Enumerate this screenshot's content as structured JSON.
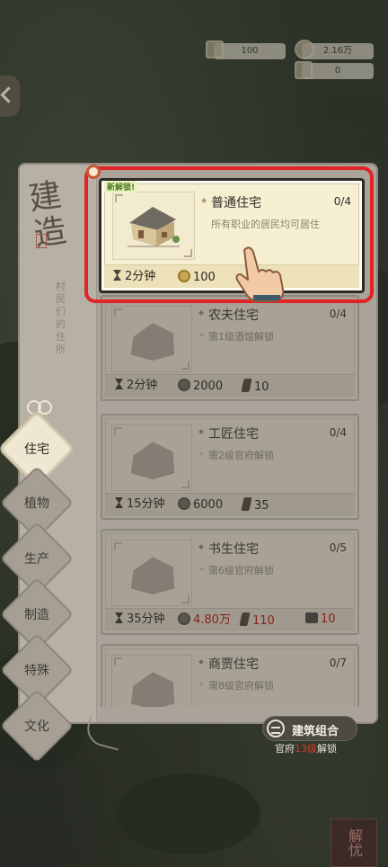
{
  "resources": {
    "wood_value": "100",
    "coin_value": "2.16万",
    "stone_value": "0"
  },
  "side": {
    "title": "建造",
    "subtitle": "村民们的住所"
  },
  "highlighted": {
    "tag": "新解锁!",
    "name": "普通住宅",
    "count": "0/4",
    "desc": "所有职业的居民均可居住",
    "time": "2分钟",
    "coins": "100"
  },
  "buildings": [
    {
      "name": "农夫住宅",
      "count": "0/4",
      "req": "需1级酒馆解锁",
      "time": "2分钟",
      "coins": "2000",
      "wood": "10",
      "stone": ""
    },
    {
      "name": "工匠住宅",
      "count": "0/4",
      "req": "需2级官府解锁",
      "time": "15分钟",
      "coins": "6000",
      "wood": "35",
      "stone": ""
    },
    {
      "name": "书生住宅",
      "count": "0/5",
      "req": "需6级官府解锁",
      "time": "35分钟",
      "coins": "4.80万",
      "wood": "110",
      "stone": "10"
    },
    {
      "name": "商贾住宅",
      "count": "0/7",
      "req": "需8级官府解锁",
      "time": "",
      "coins": "",
      "wood": "",
      "stone": ""
    }
  ],
  "tabs": [
    "住宅",
    "植物",
    "生产",
    "制造",
    "特殊",
    "文化"
  ],
  "combo": {
    "label": "建筑组合",
    "hint_prefix": "官府",
    "hint_level": "13级",
    "hint_suffix": "解锁"
  },
  "corner_button": "解忧",
  "colors": {
    "highlight_border": "#e02428",
    "card_bg": "#f6efd2",
    "red_text": "#8b2119"
  }
}
